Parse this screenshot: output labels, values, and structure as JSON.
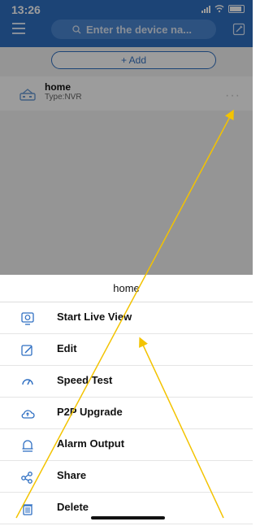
{
  "status": {
    "time": "13:26"
  },
  "search": {
    "placeholder": "Enter the device na..."
  },
  "toolbar": {
    "add_label": "+ Add"
  },
  "devices": [
    {
      "name": "home",
      "type": "Type:NVR"
    }
  ],
  "sheet": {
    "title": "home",
    "items": [
      {
        "label": "Start Live View",
        "icon": "monitor-icon"
      },
      {
        "label": "Edit",
        "icon": "edit-icon"
      },
      {
        "label": "Speed Test",
        "icon": "speedometer-icon"
      },
      {
        "label": "P2P Upgrade",
        "icon": "cloud-upgrade-icon"
      },
      {
        "label": "Alarm Output",
        "icon": "alarm-icon"
      },
      {
        "label": "Share",
        "icon": "share-icon"
      },
      {
        "label": "Delete",
        "icon": "trash-icon"
      }
    ]
  },
  "colors": {
    "accent": "#2f6fc2",
    "overlay_arrows": "#f3c300"
  }
}
